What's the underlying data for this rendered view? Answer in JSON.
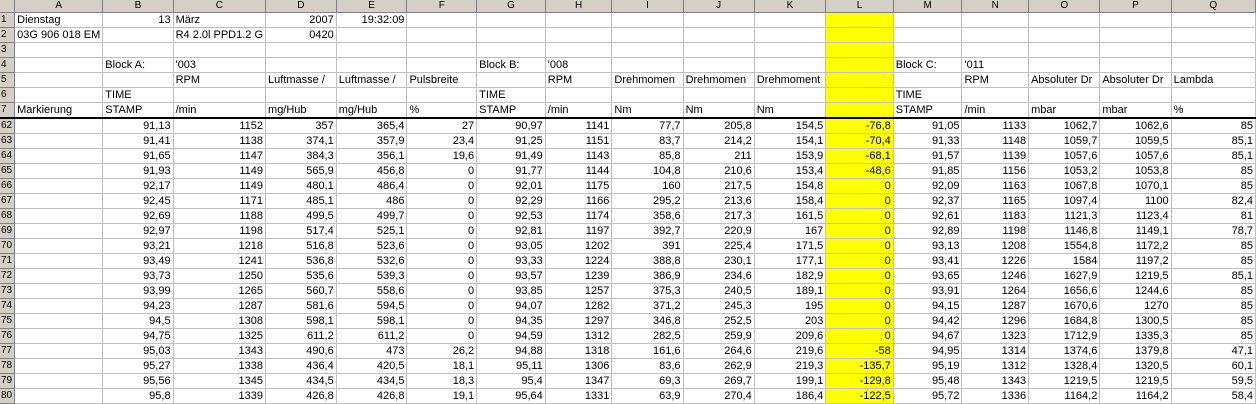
{
  "columns": [
    "A",
    "B",
    "C",
    "D",
    "E",
    "F",
    "G",
    "H",
    "I",
    "J",
    "K",
    "L",
    "M",
    "N",
    "O",
    "P",
    "Q"
  ],
  "top_rows": [
    {
      "n": "1",
      "cells": [
        "Dienstag",
        "13",
        "März",
        "2007",
        "19:32:09",
        "",
        "",
        "",
        "",
        "",
        "",
        "",
        "",
        "",
        "",
        "",
        ""
      ]
    },
    {
      "n": "2",
      "cells": [
        "03G 906 018 EM",
        "",
        "R4 2.0l PPD1.2 G",
        "0420",
        "",
        "",
        "",
        "",
        "",
        "",
        "",
        "",
        "",
        "",
        "",
        "",
        ""
      ]
    },
    {
      "n": "3",
      "cells": [
        "",
        "",
        "",
        "",
        "",
        "",
        "",
        "",
        "",
        "",
        "",
        "",
        "",
        "",
        "",
        "",
        ""
      ]
    },
    {
      "n": "4",
      "cells": [
        "",
        "Block A:",
        "'003",
        "",
        "",
        "",
        "Block B:",
        "'008",
        "",
        "",
        "",
        "",
        "Block C:",
        "'011",
        "",
        "",
        ""
      ]
    },
    {
      "n": "5",
      "cells": [
        "",
        "",
        "RPM",
        "Luftmasse /",
        "Luftmasse /",
        "Pulsbreite",
        "",
        "RPM",
        "Drehmomen",
        "Drehmomen",
        "Drehmoment",
        "",
        "",
        "RPM",
        "Absoluter Dr",
        "Absoluter Dr",
        "Lambda"
      ]
    },
    {
      "n": "6",
      "cells": [
        "",
        "TIME",
        "",
        "",
        "",
        "",
        "TIME",
        "",
        "",
        "",
        "",
        "",
        "TIME",
        "",
        "",
        "",
        ""
      ]
    },
    {
      "n": "7",
      "cells": [
        "Markierung",
        "STAMP",
        "/min",
        "mg/Hub",
        "mg/Hub",
        "%",
        "STAMP",
        "/min",
        "Nm",
        "Nm",
        "Nm",
        "",
        "STAMP",
        "/min",
        "mbar",
        "mbar",
        "%"
      ]
    }
  ],
  "data_rows": [
    {
      "n": "62",
      "cells": [
        "",
        "91,13",
        "1152",
        "357",
        "365,4",
        "27",
        "90,97",
        "1141",
        "77,7",
        "205,8",
        "154,5",
        "-76,8",
        "91,05",
        "1133",
        "1062,7",
        "1062,6",
        "85"
      ]
    },
    {
      "n": "63",
      "cells": [
        "",
        "91,41",
        "1138",
        "374,1",
        "357,9",
        "23,4",
        "91,25",
        "1151",
        "83,7",
        "214,2",
        "154,1",
        "-70,4",
        "91,33",
        "1148",
        "1059,7",
        "1059,5",
        "85,1"
      ]
    },
    {
      "n": "64",
      "cells": [
        "",
        "91,65",
        "1147",
        "384,3",
        "356,1",
        "19,6",
        "91,49",
        "1143",
        "85,8",
        "211",
        "153,9",
        "-68,1",
        "91,57",
        "1139",
        "1057,6",
        "1057,6",
        "85,1"
      ]
    },
    {
      "n": "65",
      "cells": [
        "",
        "91,93",
        "1149",
        "565,9",
        "456,8",
        "0",
        "91,77",
        "1144",
        "104,8",
        "210,6",
        "153,4",
        "-48,6",
        "91,85",
        "1156",
        "1053,2",
        "1053,8",
        "85"
      ]
    },
    {
      "n": "66",
      "cells": [
        "",
        "92,17",
        "1149",
        "480,1",
        "486,4",
        "0",
        "92,01",
        "1175",
        "160",
        "217,5",
        "154,8",
        "0",
        "92,09",
        "1163",
        "1067,8",
        "1070,1",
        "85"
      ]
    },
    {
      "n": "67",
      "cells": [
        "",
        "92,45",
        "1171",
        "485,1",
        "486",
        "0",
        "92,29",
        "1166",
        "295,2",
        "213,6",
        "158,4",
        "0",
        "92,37",
        "1165",
        "1097,4",
        "1100",
        "82,4"
      ]
    },
    {
      "n": "68",
      "cells": [
        "",
        "92,69",
        "1188",
        "499,5",
        "499,7",
        "0",
        "92,53",
        "1174",
        "358,6",
        "217,3",
        "161,5",
        "0",
        "92,61",
        "1183",
        "1121,3",
        "1123,4",
        "81"
      ]
    },
    {
      "n": "69",
      "cells": [
        "",
        "92,97",
        "1198",
        "517,4",
        "525,1",
        "0",
        "92,81",
        "1197",
        "392,7",
        "220,9",
        "167",
        "0",
        "92,89",
        "1198",
        "1146,8",
        "1149,1",
        "78,7"
      ]
    },
    {
      "n": "70",
      "cells": [
        "",
        "93,21",
        "1218",
        "516,8",
        "523,6",
        "0",
        "93,05",
        "1202",
        "391",
        "225,4",
        "171,5",
        "0",
        "93,13",
        "1208",
        "1554,8",
        "1172,2",
        "85"
      ]
    },
    {
      "n": "71",
      "cells": [
        "",
        "93,49",
        "1241",
        "536,8",
        "532,6",
        "0",
        "93,33",
        "1224",
        "388,8",
        "230,1",
        "177,1",
        "0",
        "93,41",
        "1226",
        "1584",
        "1197,2",
        "85"
      ]
    },
    {
      "n": "72",
      "cells": [
        "",
        "93,73",
        "1250",
        "535,6",
        "539,3",
        "0",
        "93,57",
        "1239",
        "386,9",
        "234,6",
        "182,9",
        "0",
        "93,65",
        "1246",
        "1627,9",
        "1219,5",
        "85,1"
      ]
    },
    {
      "n": "73",
      "cells": [
        "",
        "93,99",
        "1265",
        "560,7",
        "558,6",
        "0",
        "93,85",
        "1257",
        "375,3",
        "240,5",
        "189,1",
        "0",
        "93,91",
        "1264",
        "1656,6",
        "1244,6",
        "85"
      ]
    },
    {
      "n": "74",
      "cells": [
        "",
        "94,23",
        "1287",
        "581,6",
        "594,5",
        "0",
        "94,07",
        "1282",
        "371,2",
        "245,3",
        "195",
        "0",
        "94,15",
        "1287",
        "1670,6",
        "1270",
        "85"
      ]
    },
    {
      "n": "75",
      "cells": [
        "",
        "94,5",
        "1308",
        "598,1",
        "598,1",
        "0",
        "94,35",
        "1297",
        "346,8",
        "252,5",
        "203",
        "0",
        "94,42",
        "1296",
        "1684,8",
        "1300,5",
        "85"
      ]
    },
    {
      "n": "76",
      "cells": [
        "",
        "94,75",
        "1325",
        "611,2",
        "611,2",
        "0",
        "94,59",
        "1312",
        "282,5",
        "259,9",
        "209,6",
        "0",
        "94,67",
        "1323",
        "1712,9",
        "1335,3",
        "85"
      ]
    },
    {
      "n": "77",
      "cells": [
        "",
        "95,03",
        "1343",
        "490,6",
        "473",
        "26,2",
        "94,88",
        "1318",
        "161,6",
        "264,6",
        "219,6",
        "-58",
        "94,95",
        "1314",
        "1374,6",
        "1379,8",
        "47,1"
      ]
    },
    {
      "n": "78",
      "cells": [
        "",
        "95,27",
        "1338",
        "436,4",
        "420,5",
        "18,1",
        "95,11",
        "1306",
        "83,6",
        "262,9",
        "219,3",
        "-135,7",
        "95,19",
        "1312",
        "1328,4",
        "1320,5",
        "60,1"
      ]
    },
    {
      "n": "79",
      "cells": [
        "",
        "95,56",
        "1345",
        "434,5",
        "434,5",
        "18,3",
        "95,4",
        "1347",
        "69,3",
        "269,7",
        "199,1",
        "-129,8",
        "95,48",
        "1343",
        "1219,5",
        "1219,5",
        "59,5"
      ]
    },
    {
      "n": "80",
      "cells": [
        "",
        "95,8",
        "1339",
        "426,8",
        "426,8",
        "19,1",
        "95,64",
        "1331",
        "63,9",
        "270,4",
        "186,4",
        "-122,5",
        "95,72",
        "1336",
        "1164,2",
        "1164,2",
        "58,4"
      ]
    }
  ],
  "highlight_column": "L",
  "highlight_color": "#ffff00"
}
